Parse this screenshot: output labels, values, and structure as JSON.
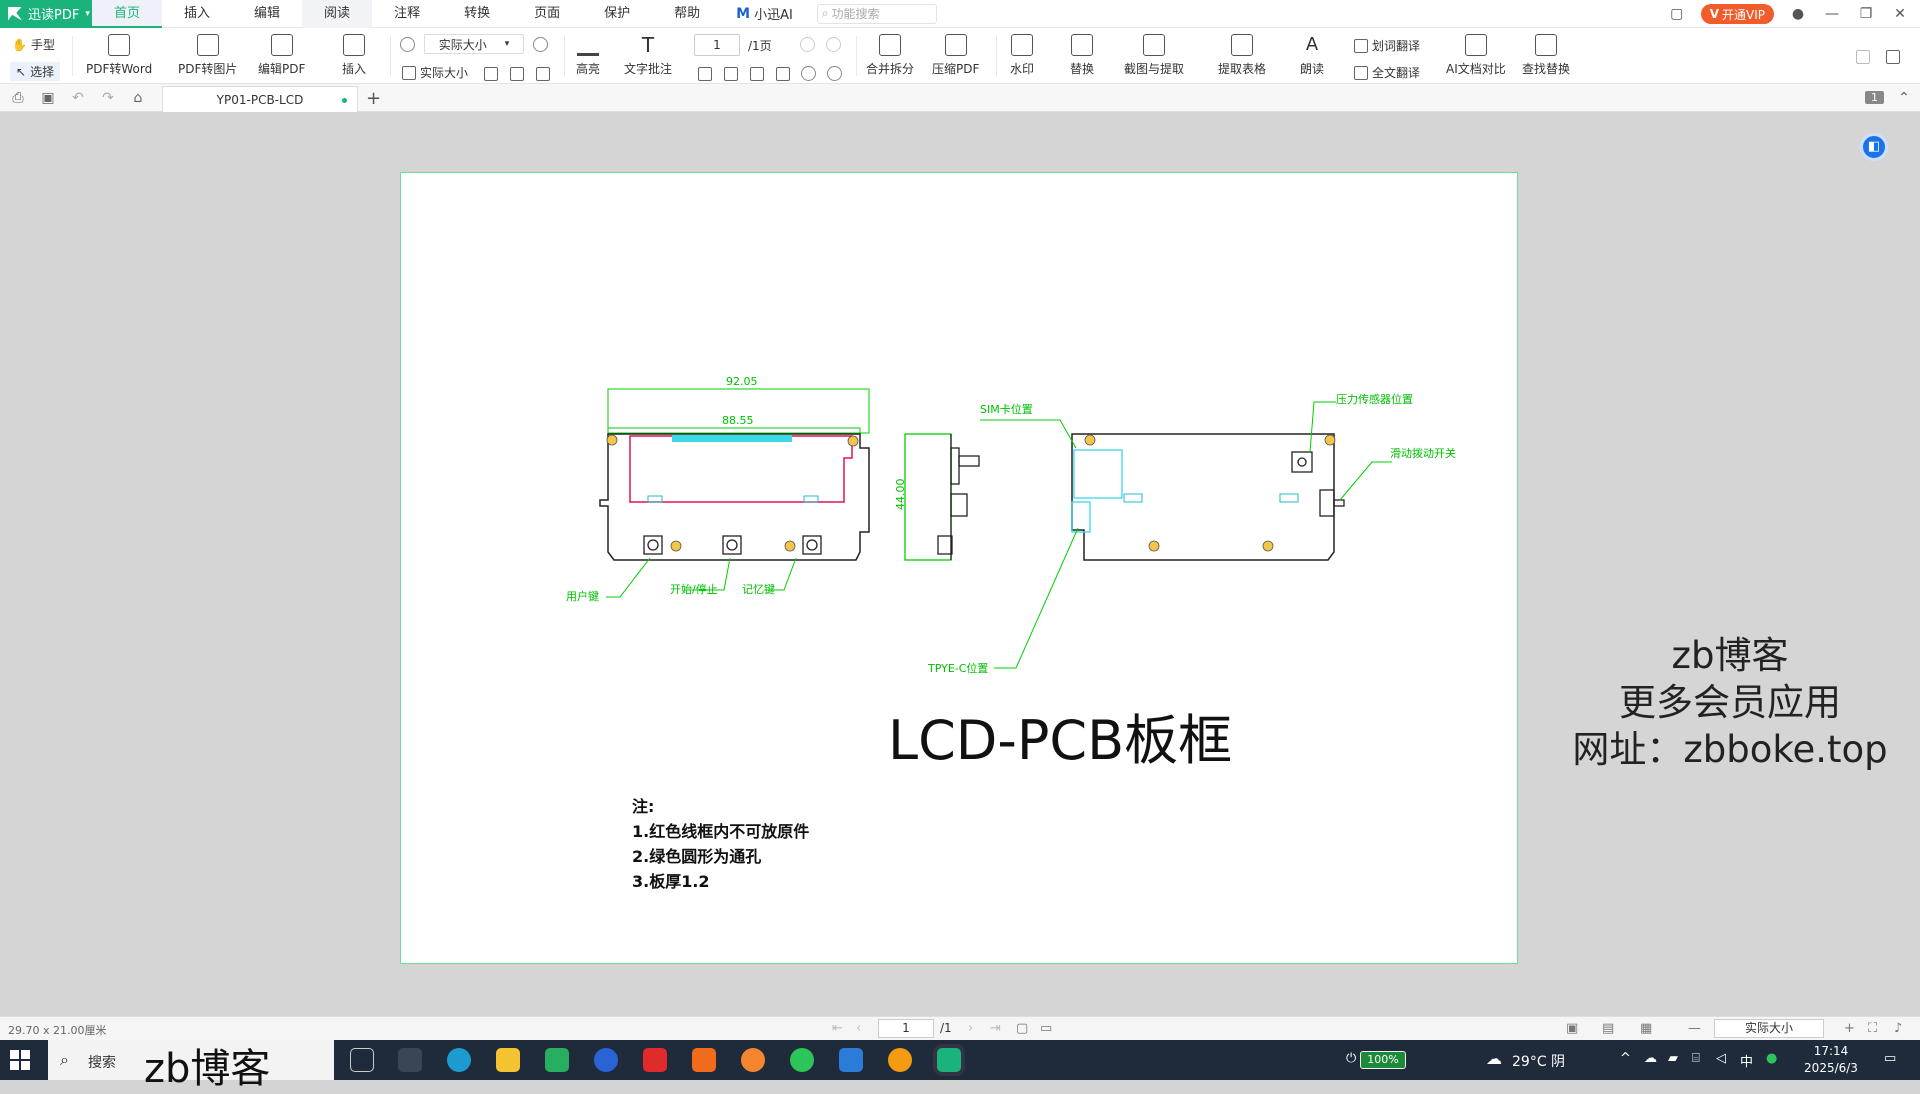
{
  "app": {
    "name": "迅读PDF"
  },
  "menu": {
    "tabs": [
      "首页",
      "插入",
      "编辑",
      "阅读",
      "注释",
      "转换",
      "页面",
      "保护",
      "帮助"
    ],
    "ai_label": "小迅AI",
    "search_placeholder": "功能搜索",
    "vip_label": "开通VIP"
  },
  "ribbon": {
    "hand_tool": "手型",
    "select_tool": "选择",
    "pdf_to_word": "PDF转Word",
    "pdf_to_image": "PDF转图片",
    "edit_pdf": "编辑PDF",
    "insert": "插入",
    "zoom_value": "实际大小",
    "actual_size": "实际大小",
    "highlight": "高亮",
    "text_note": "文字批注",
    "page_current": "1",
    "page_total": "/1页",
    "merge_split": "合并拆分",
    "compress": "压缩PDF",
    "watermark": "水印",
    "replace": "替换",
    "screenshot_extract": "截图与提取",
    "extract_table": "提取表格",
    "read_aloud": "朗读",
    "word_translate": "划词翻译",
    "full_translate": "全文翻译",
    "ai_compare": "AI文档对比",
    "find_replace": "查找替换"
  },
  "tabbar": {
    "doc_name": "YP01-PCB-LCD",
    "page_badge": "1"
  },
  "drawing": {
    "dim_outer": "92.05",
    "dim_inner": "88.55",
    "dim_height": "44.00",
    "labels": {
      "user_key": "用户键",
      "start_stop": "开始/停止",
      "memory": "记忆键",
      "sim": "SIM卡位置",
      "pressure": "压力传感器位置",
      "switch": "滑动拨动开关",
      "typec": "TPYE-C位置"
    }
  },
  "title": "LCD-PCB板框",
  "notes": [
    "注:",
    "1.红色线框内不可放原件",
    "2.绿色圆形为通孔",
    "3.板厚1.2"
  ],
  "watermark": [
    "zb博客",
    "更多会员应用",
    "网址：zbboke.top"
  ],
  "status": {
    "page_size": "29.70 x 21.00厘米",
    "page_current": "1",
    "page_total": "/1",
    "zoom": "实际大小"
  },
  "taskbar": {
    "search_label": "搜索",
    "brand": "zb博客",
    "battery": "100%",
    "weather": "29°C 阴",
    "ime": "中",
    "time": "17:14",
    "date": "2025/6/3"
  }
}
